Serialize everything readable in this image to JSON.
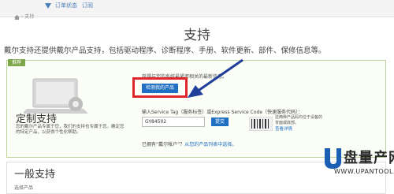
{
  "topbar": {
    "item1": "订单状态",
    "item2": "订阅"
  },
  "breadcrumb": {
    "current": "支持"
  },
  "page": {
    "title": "支持",
    "intro": "戴尔支持还提供戴尔产品支持，包括驱动程序、诊断程序、手册、软件更新、部件、保修信息等。"
  },
  "custom_support": {
    "tag": "推荐",
    "title": "定制支持",
    "description": "您的戴尔产品专属于您，我们的支持也专属于您。确定您的特定产品，以获得个性化帮助。",
    "detect_text": "获得与您的系统最紧密相关的最新信息。",
    "detect_button": "检测我的产品",
    "service_tag_label": "输入Service Tag（服务标签）或Express Service Code（快速服务代码）：",
    "service_tag_value": "GY84502",
    "submit_button": "提交",
    "service_hint": "这两种产品码均位于设备的背面或底部。",
    "more_link": "查看详情",
    "account_prefix": "已拥有“戴尔帐户”？",
    "account_link": "从您的产品列表中选择。"
  },
  "general_support": {
    "title": "一般支持",
    "subtitle": "选择产品"
  },
  "watermark": {
    "brand": "盘量产网",
    "url": "WWW.UPANTOOL.COM"
  },
  "colors": {
    "accent": "#1f6fc2",
    "highlight": "#e0252b",
    "panel_border": "#bcd39a",
    "tag": "#7ea849"
  }
}
